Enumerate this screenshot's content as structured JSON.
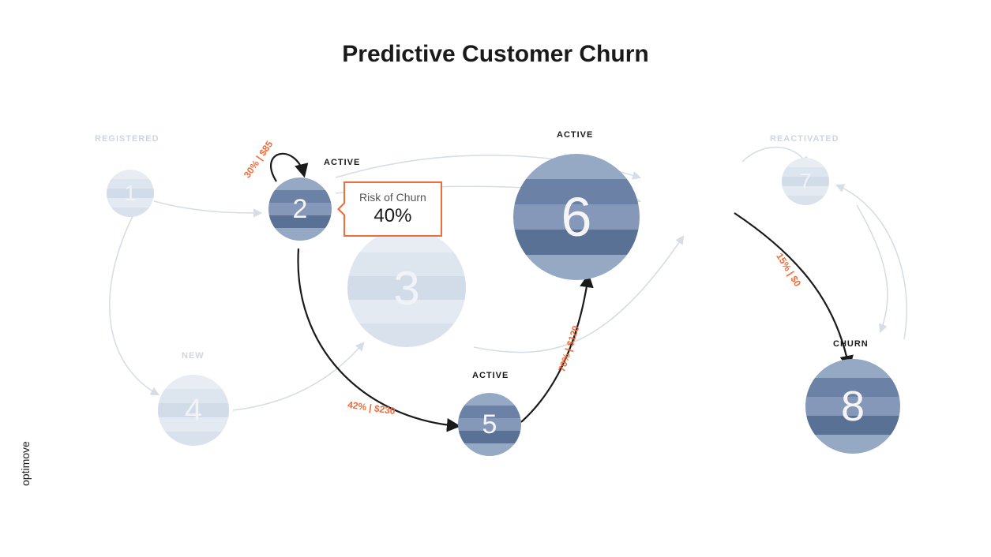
{
  "title": "Predictive Customer Churn",
  "brand": "optimove",
  "tooltip": {
    "label": "Risk of Churn",
    "value": "40%"
  },
  "nodes": {
    "n1": {
      "num": "1",
      "label": "REGISTERED"
    },
    "n2": {
      "num": "2",
      "label": "ACTIVE"
    },
    "n3": {
      "num": "3",
      "label": ""
    },
    "n4": {
      "num": "4",
      "label": "NEW"
    },
    "n5": {
      "num": "5",
      "label": "ACTIVE"
    },
    "n6": {
      "num": "6",
      "label": "ACTIVE"
    },
    "n7": {
      "num": "7",
      "label": "REACTIVATED"
    },
    "n8": {
      "num": "8",
      "label": "CHURN"
    }
  },
  "edges": {
    "e_self2": {
      "label": "30% | $85"
    },
    "e_2_5": {
      "label": "42% | $230"
    },
    "e_5_6": {
      "label": "70% | $120"
    },
    "e_6_8": {
      "label": "15% | $0"
    }
  }
}
